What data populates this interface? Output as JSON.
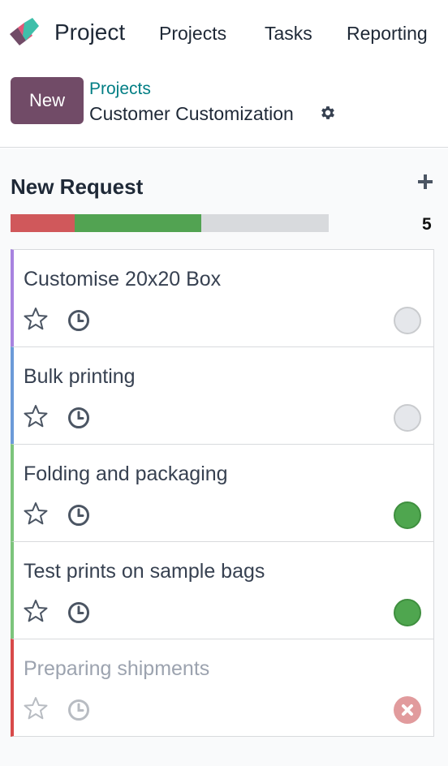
{
  "navbar": {
    "app_name": "Project",
    "menu": [
      "Projects",
      "Tasks",
      "Reporting"
    ]
  },
  "control_panel": {
    "new_button": "New",
    "breadcrumb_parent": "Projects",
    "breadcrumb_current": "Customer Customization"
  },
  "column": {
    "title": "New Request",
    "count": "5",
    "progress": {
      "red_fraction": 0.2,
      "green_fraction": 0.4,
      "grey_fraction": 0.4
    }
  },
  "cards": [
    {
      "title": "Customise 20x20 Box",
      "accent": "#a883e0",
      "status": "normal"
    },
    {
      "title": "Bulk printing",
      "accent": "#6c9bd8",
      "status": "normal"
    },
    {
      "title": "Folding and packaging",
      "accent": "#7cc47c",
      "status": "done"
    },
    {
      "title": "Test prints on sample bags",
      "accent": "#7cc47c",
      "status": "done"
    },
    {
      "title": "Preparing shipments",
      "accent": "#d84a4a",
      "status": "blocked"
    }
  ],
  "colors": {
    "brand": "#714b67",
    "link": "#017e84",
    "status_done": "#4fa64f",
    "status_blocked": "#e19b9d"
  },
  "icons": [
    "project-logo-icon",
    "gear-icon",
    "plus-icon",
    "star-icon",
    "clock-icon",
    "close-icon"
  ]
}
